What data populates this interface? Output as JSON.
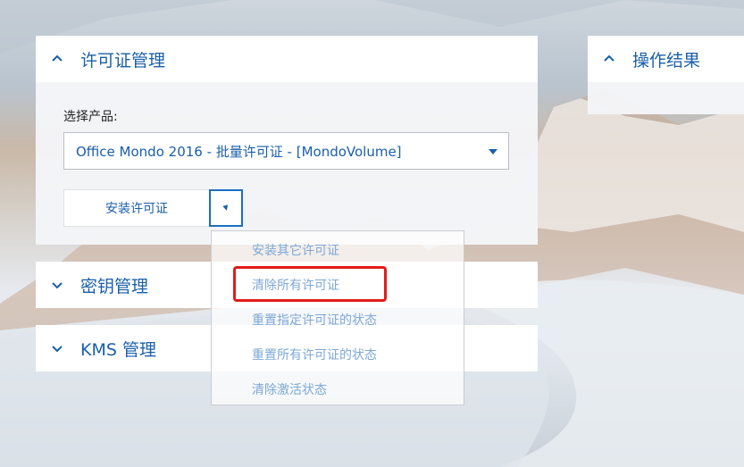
{
  "license_panel": {
    "title": "许可证管理",
    "select_label": "选择产品:",
    "product_selected": "Office Mondo 2016 - 批量许可证 - [MondoVolume]",
    "install_button": "安装许可证",
    "dropdown_items": [
      "安装其它许可证",
      "清除所有许可证",
      "重置指定许可证的状态",
      "重置所有许可证的状态",
      "清除激活状态"
    ]
  },
  "key_panel": {
    "title": "密钥管理"
  },
  "kms_panel": {
    "title": "KMS 管理"
  },
  "result_panel": {
    "title": "操作结果"
  },
  "colors": {
    "accent": "#1a5fa8",
    "menu_text": "#7ea8d6",
    "highlight": "#e21b1b"
  }
}
